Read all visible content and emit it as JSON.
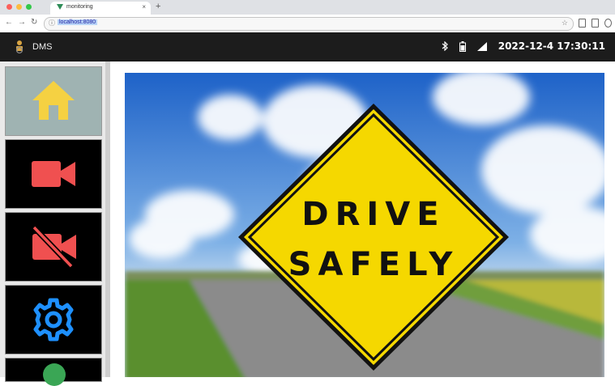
{
  "browser": {
    "tab_title": "monitoring",
    "tab_close": "×",
    "new_tab": "+",
    "url": "localhost:8080",
    "info_icon": "info-icon",
    "star_icon": "bookmark-star-icon"
  },
  "app": {
    "name": "DMS",
    "datetime": "2022-12-4 17:30:11",
    "status_icons": [
      "bluetooth-icon",
      "battery-icon",
      "signal-icon"
    ]
  },
  "sidebar": {
    "items": [
      {
        "icon": "home-icon",
        "active": true,
        "color": "#f5d142"
      },
      {
        "icon": "video-camera-icon",
        "active": false,
        "color": "#f05050"
      },
      {
        "icon": "video-camera-off-icon",
        "active": false,
        "color": "#f05050"
      },
      {
        "icon": "gear-icon",
        "active": false,
        "color": "#1e90ff"
      }
    ]
  },
  "banner": {
    "line1": "DRIVE",
    "line2": "SAFELY"
  },
  "colors": {
    "sign_yellow": "#f5d800",
    "appbar": "#1c1c1c",
    "home_bg": "#9fb3b2"
  }
}
